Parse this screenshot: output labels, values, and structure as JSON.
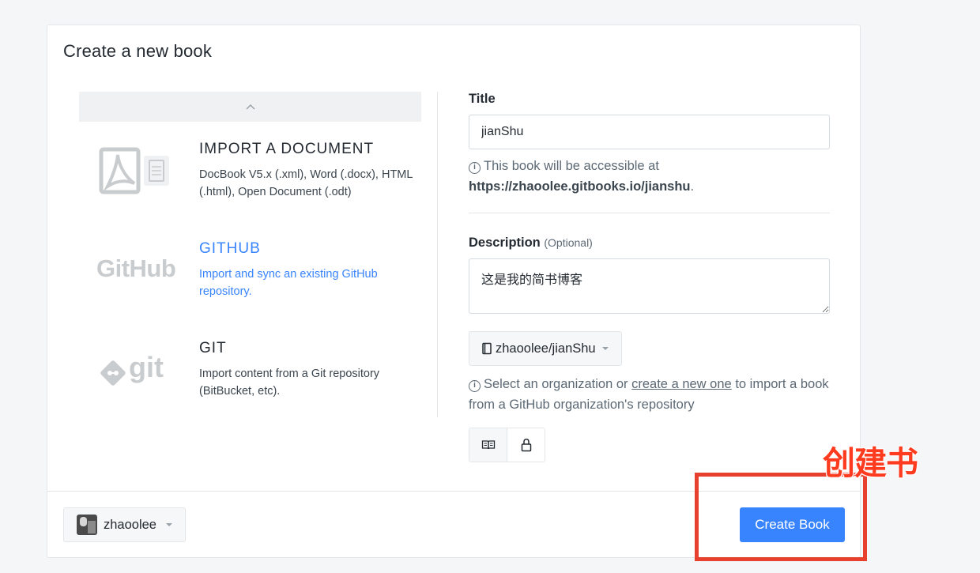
{
  "dialog": {
    "title": "Create a new book"
  },
  "sources": [
    {
      "title": "IMPORT A DOCUMENT",
      "description": "DocBook V5.x (.xml), Word (.docx), HTML (.html), Open Document (.odt)",
      "icon": "pdf-doc-icon"
    },
    {
      "title": "GITHUB",
      "description": "Import and sync an existing GitHub repository.",
      "logo_text": "GitHub",
      "icon": "github-logo"
    },
    {
      "title": "GIT",
      "description": "Import content from a Git repository (BitBucket, etc).",
      "logo_text": "git",
      "icon": "git-logo"
    }
  ],
  "form": {
    "title_label": "Title",
    "title_value": "jianShu",
    "url_hint_prefix": "This book will be accessible at",
    "url": "https://zhaoolee.gitbooks.io/jianshu",
    "url_suffix": ".",
    "description_label": "Description",
    "description_optional": "(Optional)",
    "description_value": "这是我的简书博客",
    "repo_select": "zhaoolee/jianShu",
    "org_hint_prefix": "Select an organization or",
    "org_hint_link": "create a new one",
    "org_hint_suffix": "to import a book from a GitHub organization's repository"
  },
  "footer": {
    "account": "zhaoolee",
    "create_button": "Create Book"
  },
  "annotation": {
    "text": "创建书",
    "color": "#e8402f"
  },
  "colors": {
    "accent": "#3884ff",
    "border": "#e3e6e8"
  }
}
